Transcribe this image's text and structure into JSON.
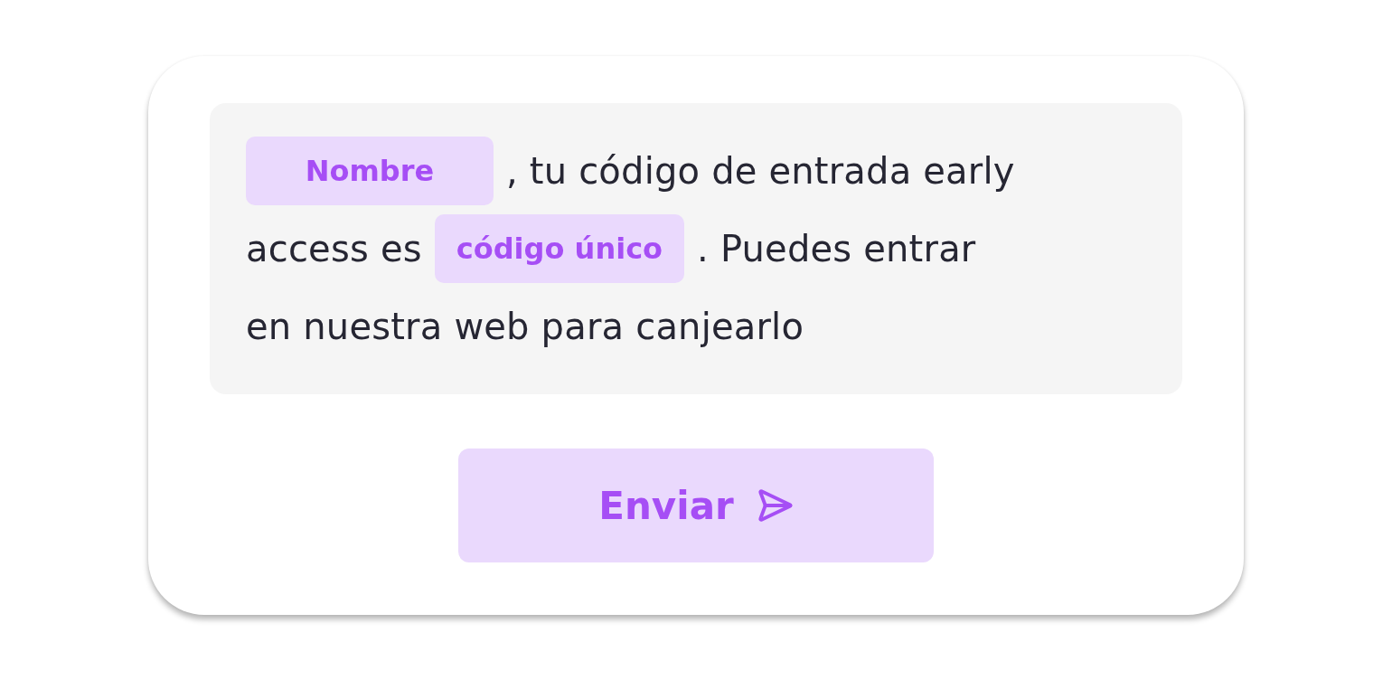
{
  "message": {
    "lines": [
      [
        {
          "kind": "tag",
          "text": "Nombre"
        },
        {
          "kind": "text",
          "text": ", tu código de entrada early"
        }
      ],
      [
        {
          "kind": "text",
          "text": "access es"
        },
        {
          "kind": "tag",
          "text": "código único"
        },
        {
          "kind": "text",
          "text": ". Puedes entrar"
        }
      ],
      [
        {
          "kind": "text",
          "text": "en nuestra web para canjearlo"
        }
      ]
    ]
  },
  "button": {
    "label": "Enviar"
  }
}
